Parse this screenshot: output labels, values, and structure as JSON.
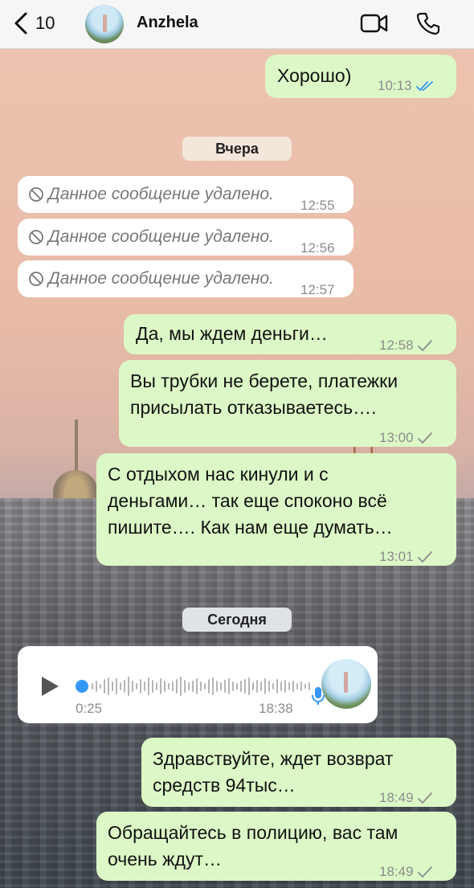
{
  "header": {
    "back_count": "10",
    "contact_name": "Anzhela"
  },
  "date_separators": {
    "yesterday": "Вчера",
    "today": "Сегодня"
  },
  "messages": [
    {
      "id": "m1",
      "direction": "out",
      "text": "Хорошо)",
      "time": "10:13",
      "status": "read"
    },
    {
      "id": "m2",
      "direction": "in",
      "text": "Данное сообщение удалено.",
      "time": "12:55",
      "deleted": true
    },
    {
      "id": "m3",
      "direction": "in",
      "text": "Данное сообщение удалено.",
      "time": "12:56",
      "deleted": true
    },
    {
      "id": "m4",
      "direction": "in",
      "text": "Данное сообщение удалено.",
      "time": "12:57",
      "deleted": true
    },
    {
      "id": "m5",
      "direction": "out",
      "text": "Да, мы ждем деньги…",
      "time": "12:58",
      "status": "sent"
    },
    {
      "id": "m6",
      "direction": "out",
      "lines": [
        "Вы трубки не берете, платежки",
        "присылать отказываетесь…."
      ],
      "time": "13:00",
      "status": "sent"
    },
    {
      "id": "m7",
      "direction": "out",
      "lines": [
        "С отдыхом нас кинули и с",
        "деньгами… так еще споконо всё",
        "пишите…. Как нам еще думать…"
      ],
      "time": "13:01",
      "status": "sent"
    },
    {
      "id": "m8",
      "direction": "in",
      "type": "voice",
      "duration": "0:25",
      "time": "18:38",
      "progress": 0.0
    },
    {
      "id": "m9",
      "direction": "out",
      "lines": [
        "Здравствуйте, ждет возврат",
        "средств 94тыс…"
      ],
      "time": "18:49",
      "status": "sent"
    },
    {
      "id": "m10",
      "direction": "out",
      "lines": [
        "Обращайтесь в полицию, вас там",
        "очень ждут…"
      ],
      "time": "18:49",
      "status": "sent"
    }
  ],
  "colors": {
    "outgoing_bubble": "#dcf8c6",
    "incoming_bubble": "#ffffff",
    "read_check": "#3497f9",
    "sent_check": "#8c8c8c"
  }
}
